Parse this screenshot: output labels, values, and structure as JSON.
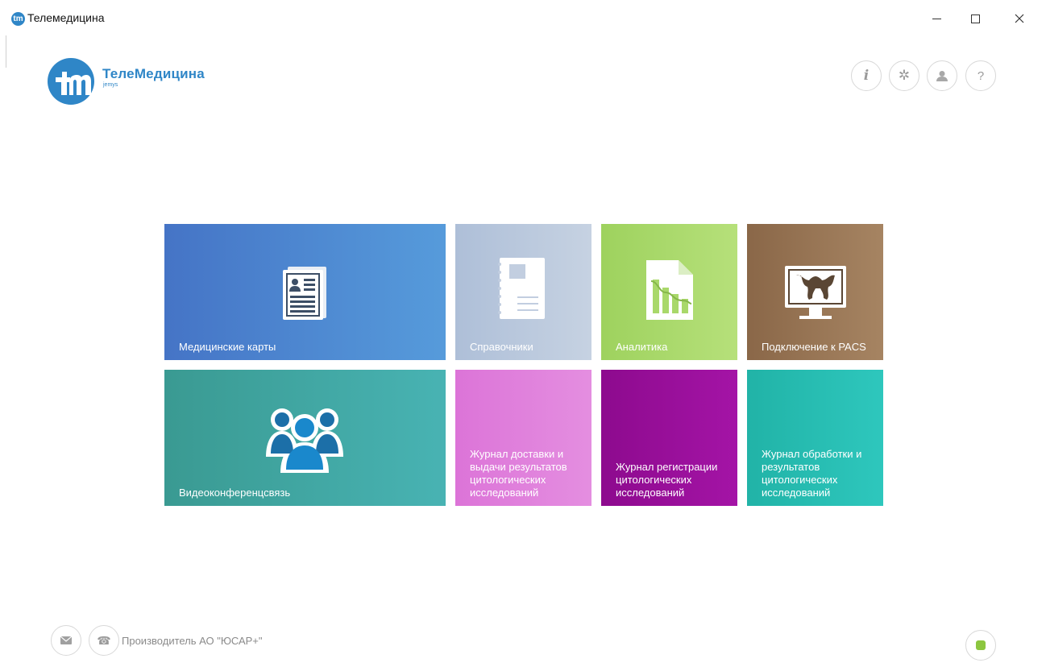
{
  "window": {
    "title": "Телемедицина",
    "app_icon_glyph": "tm",
    "minimize_icon": "minimize-icon",
    "maximize_icon": "maximize-icon",
    "close_glyph": "✕"
  },
  "logo": {
    "name": "ТелеМедицина",
    "sub": "jemys",
    "color": "#2f86c7"
  },
  "toolbar": {
    "info_glyph": "i",
    "settings_glyph": "✲",
    "user_glyph": "👤",
    "help_glyph": "?"
  },
  "tiles": [
    {
      "label": "Медицинские карты",
      "icon": "medical-card-icon",
      "color": "#4f8ad2"
    },
    {
      "label": "Справочники",
      "icon": "reference-book-icon",
      "color": "#b8c7dc"
    },
    {
      "label": "Аналитика",
      "icon": "analytics-chart-icon",
      "color": "#a9d86a"
    },
    {
      "label": "Подключение к PACS",
      "icon": "pacs-monitor-icon",
      "color": "#987655"
    },
    {
      "label": "Видеоконференцсвязь",
      "icon": "video-conference-icon",
      "color": "#41a8a4"
    },
    {
      "label": "Журнал доставки и выдачи результатов цитологических исследований",
      "icon": "",
      "color": "#e080dc"
    },
    {
      "label": "Журнал регистрации цитологических исследований",
      "icon": "",
      "color": "#980f9a"
    },
    {
      "label": "Журнал обработки и результатов цитологических исследований",
      "icon": "",
      "color": "#27bdb2"
    }
  ],
  "footer": {
    "mail_glyph": "✉",
    "phone_glyph": "☎",
    "manufacturer": "Производитель АО \"ЮСАР+\"",
    "db_icon": "database-status-icon"
  }
}
